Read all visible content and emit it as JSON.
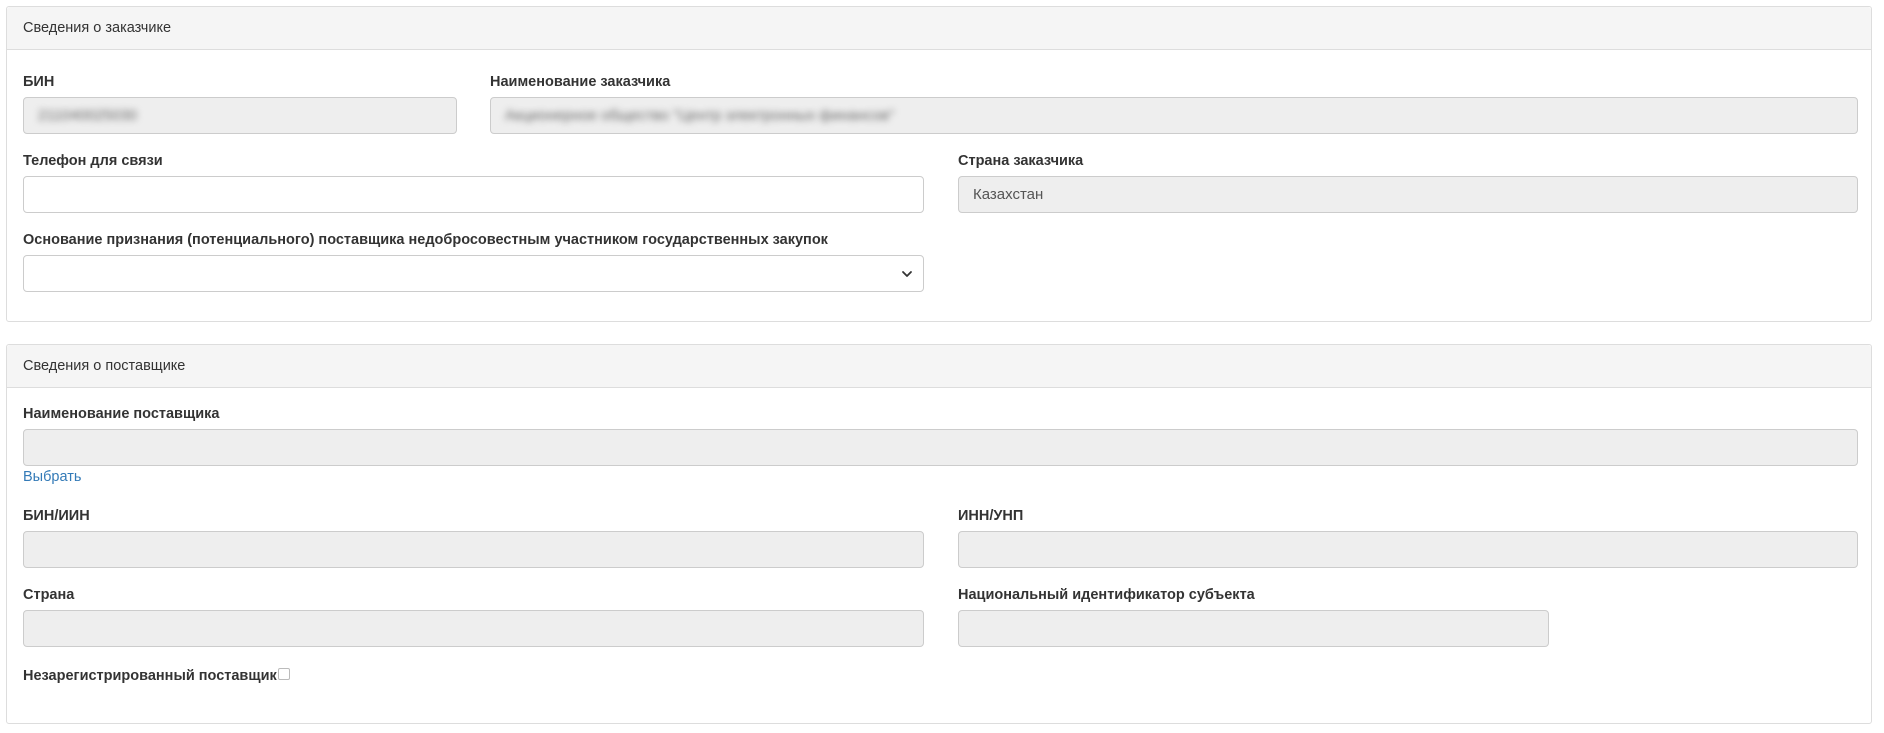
{
  "customer_panel": {
    "heading": "Сведения о заказчике",
    "bin": {
      "label": "БИН",
      "value": "211040025030"
    },
    "customer_name": {
      "label": "Наименование заказчика",
      "value": "Акционерное общество \"Центр электронных финансов\""
    },
    "phone": {
      "label": "Телефон для связи",
      "value": ""
    },
    "customer_country": {
      "label": "Страна заказчика",
      "value": "Казахстан"
    },
    "basis": {
      "label": "Основание признания (потенциального) поставщика недобросовестным участником государственных закупок",
      "selected": ""
    }
  },
  "supplier_panel": {
    "heading": "Сведения о поставщике",
    "supplier_name": {
      "label": "Наименование поставщика",
      "value": ""
    },
    "select_link": "Выбрать",
    "bin_iin": {
      "label": "БИН/ИИН",
      "value": ""
    },
    "inn_unp": {
      "label": "ИНН/УНП",
      "value": ""
    },
    "country": {
      "label": "Страна",
      "value": ""
    },
    "national_id": {
      "label": "Национальный идентификатор субъекта",
      "value": ""
    },
    "unregistered": {
      "label": "Незарегистрированный поставщик",
      "checked": false
    }
  }
}
